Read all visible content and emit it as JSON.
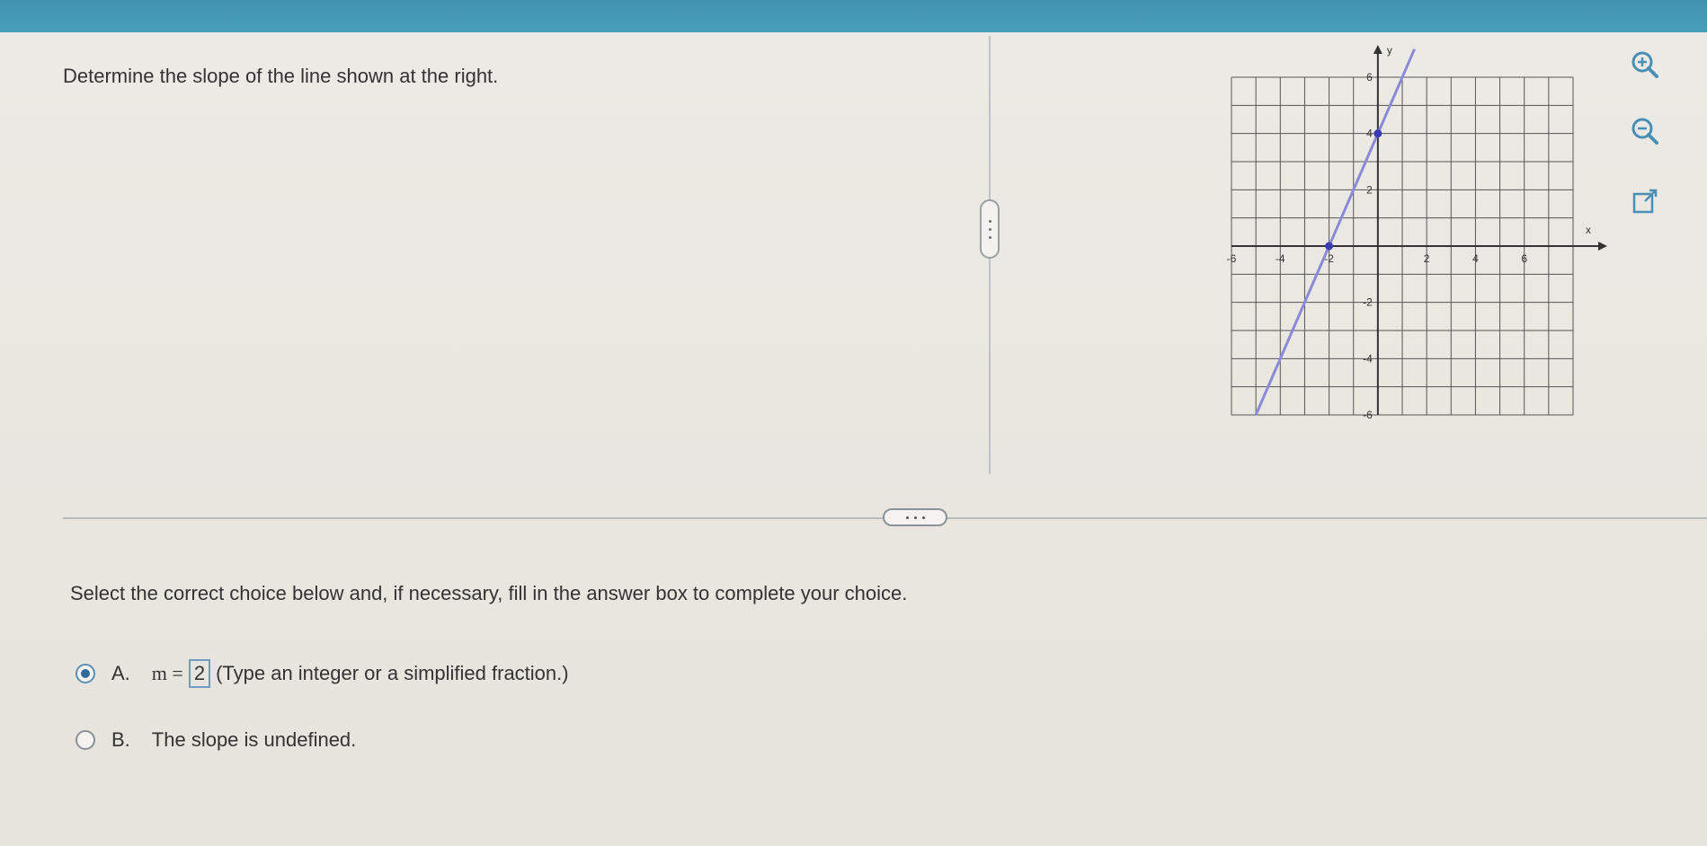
{
  "question": {
    "text": "Determine the slope of the line shown at the right."
  },
  "graph": {
    "y_axis_label": "y",
    "x_axis_label": "x",
    "x_ticks": [
      "-6",
      "-4",
      "-2",
      "2",
      "4",
      "6"
    ],
    "y_ticks": [
      "6",
      "4",
      "2",
      "-2",
      "-4",
      "-6"
    ],
    "points": [
      {
        "x": -2,
        "y": 0
      },
      {
        "x": 0,
        "y": 4
      }
    ],
    "line_color": "#8a8ad8",
    "point_color": "#3b3bb8"
  },
  "tools": {
    "zoom_in": "magnifier-plus-icon",
    "zoom_out": "magnifier-minus-icon",
    "popout": "popout-icon"
  },
  "instructions": "Select the correct choice below and, if necessary, fill in the answer box to complete your choice.",
  "choices": {
    "a": {
      "letter": "A.",
      "prefix": "m =",
      "answer": "2",
      "hint": "(Type an integer or a simplified fraction.)",
      "selected": true
    },
    "b": {
      "letter": "B.",
      "text": "The slope is undefined.",
      "selected": false
    }
  },
  "colors": {
    "header": "#4a9fba",
    "answer_border": "#6f9cc0"
  }
}
